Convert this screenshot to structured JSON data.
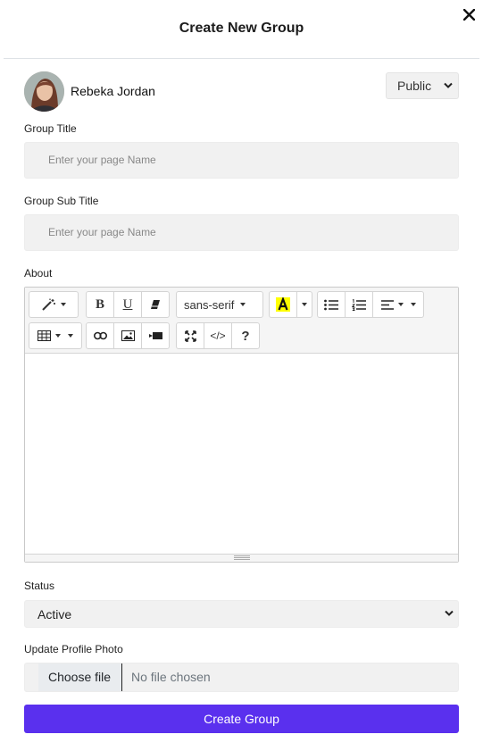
{
  "modal": {
    "title": "Create New Group",
    "close_icon": "close-icon"
  },
  "user": {
    "name": "Rebeka Jordan",
    "privacy_value": "Public"
  },
  "fields": {
    "group_title_label": "Group Title",
    "group_title_placeholder": "Enter your page Name",
    "group_subtitle_label": "Group Sub Title",
    "group_subtitle_placeholder": "Enter your page Name",
    "about_label": "About"
  },
  "toolbar": {
    "font_name": "sans-serif",
    "bold": "B",
    "underline": "U",
    "help": "?",
    "code": "</>",
    "highlight_color": "#ffff00"
  },
  "status": {
    "label": "Status",
    "value": "Active"
  },
  "photo": {
    "label": "Update Profile Photo",
    "button": "Choose file",
    "file_text": "No file chosen"
  },
  "submit": {
    "label": "Create Group",
    "color": "#5a30ee"
  }
}
